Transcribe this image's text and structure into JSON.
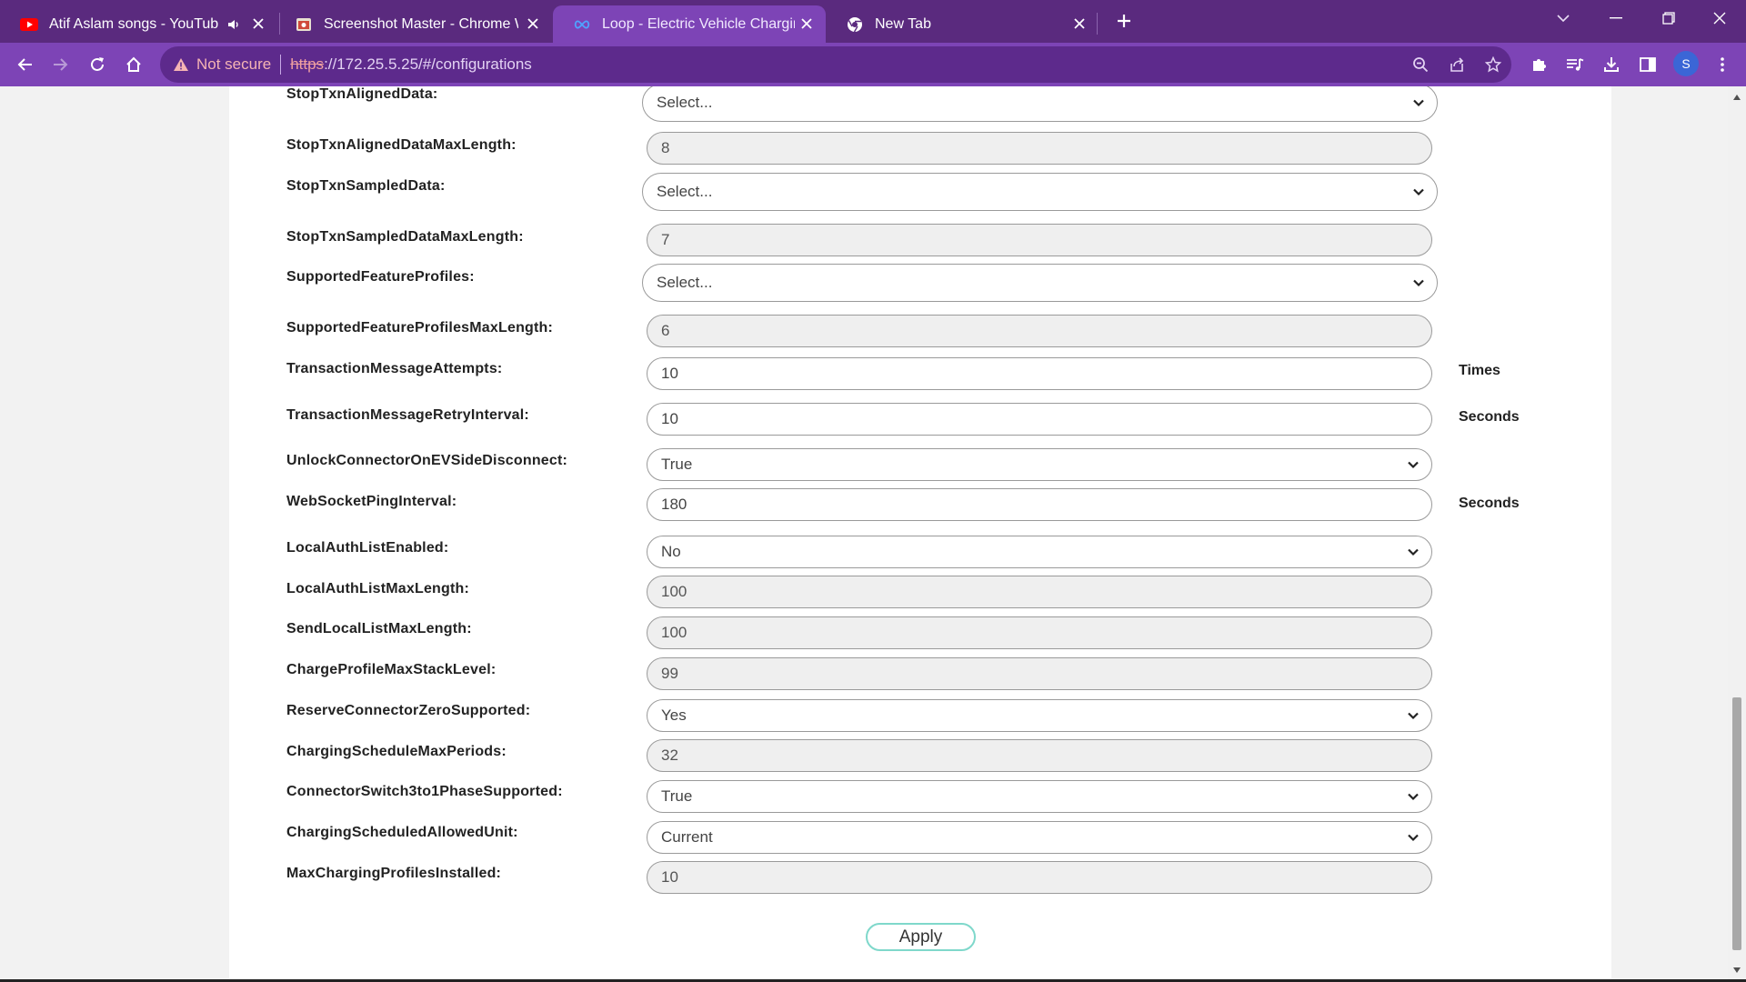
{
  "browser": {
    "tabs": [
      {
        "title": "Atif Aslam songs - YouTube",
        "favicon": "youtube-icon",
        "audio": true
      },
      {
        "title": "Screenshot Master - Chrome We",
        "favicon": "screenshot-master-icon"
      },
      {
        "title": "Loop - Electric Vehicle Charging",
        "favicon": "loop-infinity-icon",
        "active": true
      },
      {
        "title": "New Tab",
        "favicon": "chrome-icon"
      }
    ],
    "address": {
      "security": "Not secure",
      "scheme": "https",
      "rest": "://172.25.5.25/#/configurations"
    },
    "profile_initial": "S",
    "accent_color": "#7d44b6",
    "frame_color": "#5a2a7e"
  },
  "form": {
    "rows": [
      {
        "label": "StopTxnAlignedData:",
        "type": "select",
        "value": "Select...",
        "wide": true
      },
      {
        "label": "StopTxnAlignedDataMaxLength:",
        "type": "readonly",
        "value": "8"
      },
      {
        "label": "StopTxnSampledData:",
        "type": "select",
        "value": "Select...",
        "wide": true
      },
      {
        "label": "StopTxnSampledDataMaxLength:",
        "type": "readonly",
        "value": "7"
      },
      {
        "label": "SupportedFeatureProfiles:",
        "type": "select",
        "value": "Select...",
        "wide": true
      },
      {
        "label": "SupportedFeatureProfilesMaxLength:",
        "type": "readonly",
        "value": "6"
      },
      {
        "label": "TransactionMessageAttempts:",
        "type": "input",
        "value": "10",
        "unit": "Times"
      },
      {
        "label": "TransactionMessageRetryInterval:",
        "type": "input",
        "value": "10",
        "unit": "Seconds"
      },
      {
        "label": "UnlockConnectorOnEVSideDisconnect:",
        "type": "select",
        "value": "True"
      },
      {
        "label": "WebSocketPingInterval:",
        "type": "input",
        "value": "180",
        "unit": "Seconds"
      },
      {
        "label": "LocalAuthListEnabled:",
        "type": "select",
        "value": "No"
      },
      {
        "label": "LocalAuthListMaxLength:",
        "type": "readonly",
        "value": "100"
      },
      {
        "label": "SendLocalListMaxLength:",
        "type": "readonly",
        "value": "100"
      },
      {
        "label": "ChargeProfileMaxStackLevel:",
        "type": "readonly",
        "value": "99"
      },
      {
        "label": "ReserveConnectorZeroSupported:",
        "type": "select",
        "value": "Yes"
      },
      {
        "label": "ChargingScheduleMaxPeriods:",
        "type": "readonly",
        "value": "32"
      },
      {
        "label": "ConnectorSwitch3to1PhaseSupported:",
        "type": "select",
        "value": "True"
      },
      {
        "label": "ChargingScheduledAllowedUnit:",
        "type": "select",
        "value": "Current"
      },
      {
        "label": "MaxChargingProfilesInstalled:",
        "type": "readonly",
        "value": "10"
      }
    ],
    "apply_label": "Apply"
  }
}
